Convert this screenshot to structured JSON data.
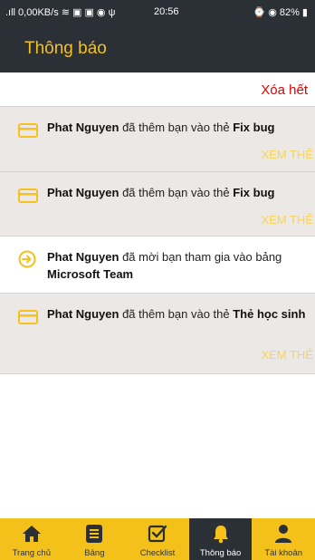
{
  "status_bar": {
    "left": ".ıll 0,00KB/s ≋ ▣ ▣ ◉ ψ",
    "time": "20:56",
    "right": "⌚ ◉ 82% ▮"
  },
  "header": {
    "title": "Thông báo"
  },
  "clear_all": "Xóa hết",
  "notifications": [
    {
      "user": "Phat Nguyen",
      "verb": " đã thêm bạn vào thẻ ",
      "target": "Fix bug",
      "action": "XEM THẺ"
    },
    {
      "user": "Phat Nguyen",
      "verb": " đã thêm bạn vào thẻ ",
      "target": "Fix bug",
      "action": "XEM THẺ"
    },
    {
      "user": "Phat Nguyen",
      "verb": " đã mời bạn tham gia vào bảng ",
      "target": "Microsoft Team"
    },
    {
      "user": "Phat Nguyen",
      "verb": " đã thêm bạn vào thẻ ",
      "target": "Thẻ học sinh",
      "action": "XEM THẺ"
    }
  ],
  "bottom_nav": [
    {
      "label": "Trang chủ",
      "icon": "home-icon"
    },
    {
      "label": "Bảng",
      "icon": "board-icon"
    },
    {
      "label": "Checklist",
      "icon": "checklist-icon"
    },
    {
      "label": "Thông báo",
      "icon": "bell-icon",
      "active": true
    },
    {
      "label": "Tài khoản",
      "icon": "user-icon"
    }
  ],
  "colors": {
    "accent": "#f5c21b",
    "dark": "#2b2f36",
    "danger": "#e00000",
    "card_bg": "#ebe8e6",
    "action_text": "#f7d45a"
  }
}
